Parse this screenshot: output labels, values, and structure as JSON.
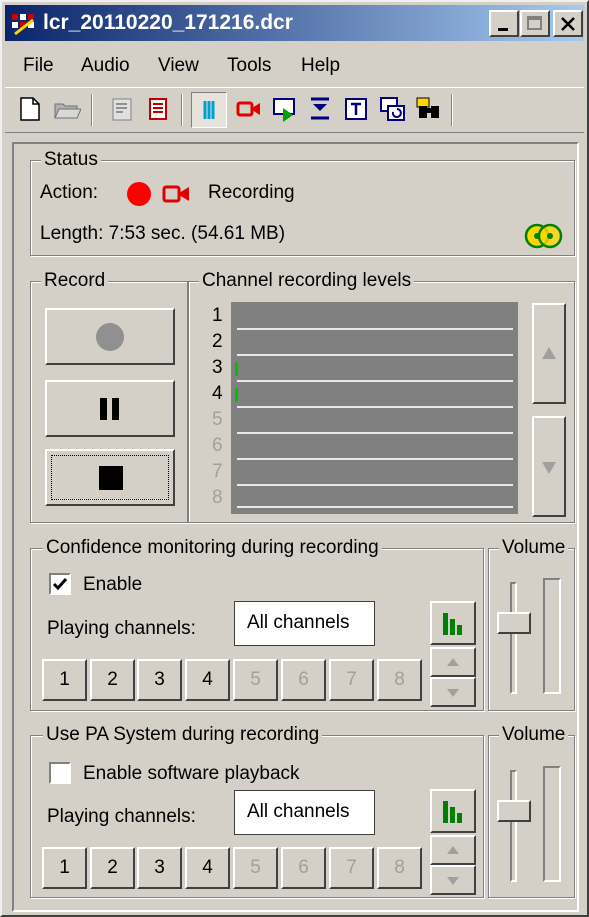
{
  "window": {
    "title": "lcr_20110220_171216.dcr"
  },
  "menu": [
    "File",
    "Audio",
    "View",
    "Tools",
    "Help"
  ],
  "toolbar": {
    "icons": [
      "new-document-icon",
      "open-folder-icon",
      "properties-icon",
      "notes-icon",
      "recording-mode-icon",
      "camera-record-icon",
      "monitor-play-icon",
      "down-marker-icon",
      "text-icon",
      "screens-icon",
      "binoculars-icon"
    ],
    "pressed": "recording-mode-icon"
  },
  "status": {
    "group_label": "Status",
    "action_label": "Action:",
    "action_value": "Recording",
    "length_text": "Length: 7:53 sec. (54.61 MB)"
  },
  "record": {
    "group_label": "Record",
    "buttons": [
      "record",
      "pause",
      "stop"
    ]
  },
  "levels": {
    "group_label": "Channel recording levels",
    "channels": [
      "1",
      "2",
      "3",
      "4",
      "5",
      "6",
      "7",
      "8"
    ],
    "active_channels": 4,
    "channels_with_signal": [
      "3",
      "4"
    ]
  },
  "confidence": {
    "group_label": "Confidence monitoring during recording",
    "enable_label": "Enable",
    "enable_checked": true,
    "playing_label": "Playing channels:",
    "playing_value": "All channels",
    "volume_label": "Volume",
    "channel_buttons": [
      "1",
      "2",
      "3",
      "4",
      "5",
      "6",
      "7",
      "8"
    ]
  },
  "pa": {
    "group_label": "Use PA System during recording",
    "enable_label": "Enable software playback",
    "enable_checked": false,
    "playing_label": "Playing channels:",
    "playing_value": "All channels",
    "volume_label": "Volume",
    "channel_buttons": [
      "1",
      "2",
      "3",
      "4",
      "5",
      "6",
      "7",
      "8"
    ]
  },
  "colors": {
    "title_gradient_start": "#0a246a",
    "title_gradient_end": "#a6caf0",
    "record_red": "#ff0000",
    "meter_green": "#00c000",
    "face": "#d4d0c8"
  }
}
